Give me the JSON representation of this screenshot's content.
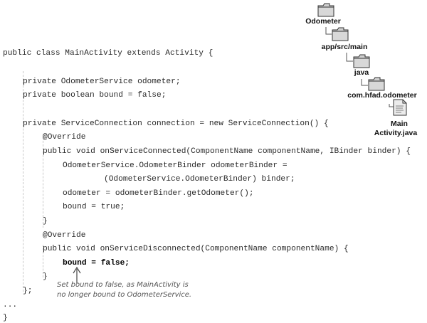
{
  "code": {
    "lines": [
      "public class MainActivity extends Activity {",
      "private OdometerService odometer;",
      "private boolean bound = false;",
      "private ServiceConnection connection = new ServiceConnection() {",
      "@Override",
      "public void onServiceConnected(ComponentName componentName, IBinder binder) {",
      "OdometerService.OdometerBinder odometerBinder =",
      "(OdometerService.OdometerBinder) binder;",
      "odometer = odometerBinder.getOdometer();",
      "bound = true;",
      "}",
      "@Override",
      "public void onServiceDisconnected(ComponentName componentName) {",
      "bound = false;",
      "}",
      "};",
      "...",
      "}"
    ]
  },
  "tree": {
    "folders": [
      "Odometer",
      "app/src/main",
      "java",
      "com.hfad.odometer"
    ],
    "file_line1": "Main",
    "file_line2": "Activity.java",
    "file_icon_text": "<Xml> </Xml>"
  },
  "annotation": {
    "line1": "Set bound to false, as MainActivity is",
    "line2": "no longer bound to OdometerService."
  }
}
